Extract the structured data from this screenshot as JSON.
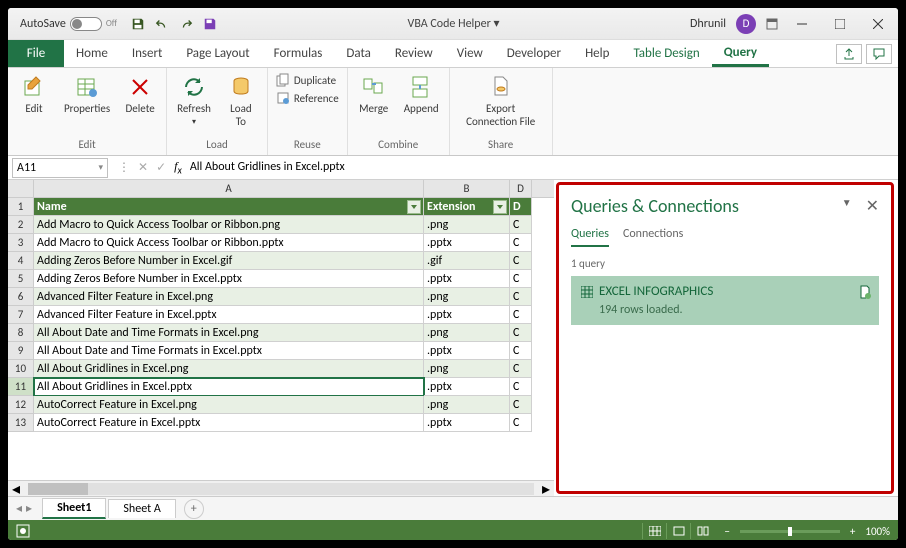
{
  "titlebar": {
    "autosave": "AutoSave",
    "autosave_state": "Off",
    "docname": "VBA Code Helper ▾",
    "user": "Dhrunil",
    "avatar": "D"
  },
  "tabs": [
    "Home",
    "Insert",
    "Page Layout",
    "Formulas",
    "Data",
    "Review",
    "View",
    "Developer",
    "Help"
  ],
  "ctx_tabs": {
    "td": "Table Design",
    "q": "Query"
  },
  "ribbon": {
    "edit": {
      "edit": "Edit",
      "properties": "Properties",
      "delete": "Delete",
      "grp": "Edit"
    },
    "load": {
      "refresh": "Refresh",
      "loadto": "Load\nTo",
      "grp": "Load"
    },
    "reuse": {
      "duplicate": "Duplicate",
      "reference": "Reference",
      "grp": "Reuse"
    },
    "combine": {
      "merge": "Merge",
      "append": "Append",
      "grp": "Combine"
    },
    "share": {
      "export": "Export\nConnection File",
      "grp": "Share"
    }
  },
  "namebox": {
    "ref": "A11",
    "formula": "All About Gridlines in Excel.pptx"
  },
  "cols": {
    "A": "A",
    "B": "B",
    "D": "D"
  },
  "headers": {
    "name": "Name",
    "ext": "Extension"
  },
  "rows": [
    {
      "n": 2,
      "name": "Add Macro to Quick Access Toolbar or Ribbon.png",
      "ext": ".png",
      "d": "C"
    },
    {
      "n": 3,
      "name": "Add Macro to Quick Access Toolbar or Ribbon.pptx",
      "ext": ".pptx",
      "d": "C"
    },
    {
      "n": 4,
      "name": "Adding Zeros Before Number in Excel.gif",
      "ext": ".gif",
      "d": "C"
    },
    {
      "n": 5,
      "name": "Adding Zeros Before Number in Excel.pptx",
      "ext": ".pptx",
      "d": "C"
    },
    {
      "n": 6,
      "name": "Advanced Filter Feature in Excel.png",
      "ext": ".png",
      "d": "C"
    },
    {
      "n": 7,
      "name": "Advanced Filter Feature in Excel.pptx",
      "ext": ".pptx",
      "d": "C"
    },
    {
      "n": 8,
      "name": "All About Date and Time Formats in Excel.png",
      "ext": ".png",
      "d": "C"
    },
    {
      "n": 9,
      "name": "All About Date and Time Formats in Excel.pptx",
      "ext": ".pptx",
      "d": "C"
    },
    {
      "n": 10,
      "name": "All About Gridlines in Excel.png",
      "ext": ".png",
      "d": "C"
    },
    {
      "n": 11,
      "name": "All About Gridlines in Excel.pptx",
      "ext": ".pptx",
      "d": "C"
    },
    {
      "n": 12,
      "name": "AutoCorrect Feature in Excel.png",
      "ext": ".png",
      "d": "C"
    },
    {
      "n": 13,
      "name": "AutoCorrect Feature in Excel.pptx",
      "ext": ".pptx",
      "d": "C"
    }
  ],
  "pane": {
    "title": "Queries & Connections",
    "tab_q": "Queries",
    "tab_c": "Connections",
    "count": "1 query",
    "qname": "EXCEL INFOGRAPHICS",
    "qstatus": "194 rows loaded."
  },
  "sheets": {
    "s1": "Sheet1",
    "sa": "Sheet A"
  },
  "status": {
    "zoom": "100%"
  },
  "file": "File"
}
